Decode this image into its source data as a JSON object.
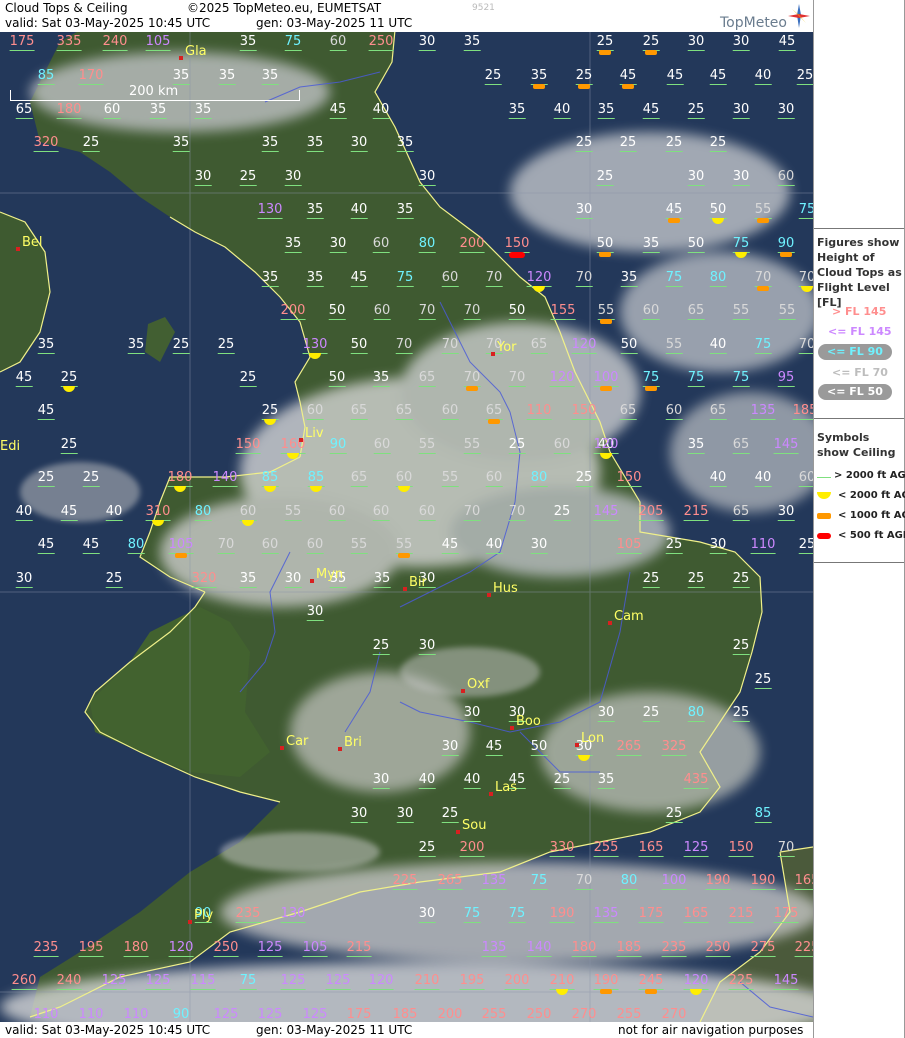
{
  "header": {
    "title": "Cloud Tops & Ceiling",
    "copyright": "©2025 TopMeteo.eu, EUMETSAT",
    "code": "9521",
    "valid": "valid:  Sat  03-May-2025  10:45 UTC",
    "gen": "gen: 03-May-2025 11 UTC",
    "logo": "TopMeteo"
  },
  "footer": {
    "valid": "valid:  Sat  03-May-2025  10:45 UTC",
    "gen": "gen: 03-May-2025 11 UTC",
    "disclaimer": "not for air navigation purposes"
  },
  "scale": {
    "label": "200 km"
  },
  "legend": {
    "figures_title": "Figures show Height of Cloud Tops as Flight Level  [FL]",
    "fl_above_145": "> FL 145",
    "fl_145": "<= FL 145",
    "fl_90": "<= FL 90",
    "fl_70": "<= FL 70",
    "fl_50": "<= FL 50",
    "symbols_title": "Symbols show Ceiling",
    "sym_2000_plus": "> 2000 ft AGL",
    "sym_2000": "< 2000 ft AGL",
    "sym_1000": "< 1000 ft AGL",
    "sym_500": "< 500 ft AGL",
    "colors": {
      "above145": "#ff8e8e",
      "fl145": "#cc88ff",
      "fl90": "#6ff2ff",
      "fl70": "#d9d9d9",
      "fl50": "#ffffff",
      "ok": "#7fe07f",
      "lt2000": "#ffee00",
      "lt1000": "#ff9800",
      "lt500": "#ff0000"
    }
  },
  "cities": [
    "Gla",
    "Bel",
    "Edi",
    "Yor",
    "Liv",
    "Myn",
    "Bir",
    "Hus",
    "Cam",
    "Oxf",
    "Boo",
    "Lon",
    "Car",
    "Bri",
    "Las",
    "Sou",
    "Ply"
  ],
  "fl_values": [
    {
      "v": "175",
      "c": "pk"
    },
    {
      "v": "335",
      "c": "pk"
    },
    {
      "v": "240",
      "c": "pk"
    },
    {
      "v": "105",
      "c": "pu"
    },
    {
      "v": "35",
      "c": "w"
    },
    {
      "v": "75",
      "c": "cy"
    },
    {
      "v": "60",
      "c": "g"
    },
    {
      "v": "250",
      "c": "pk"
    },
    {
      "v": "30",
      "c": "w"
    },
    {
      "v": "35",
      "c": "w"
    },
    {
      "v": "25",
      "c": "w",
      "s": "o"
    },
    {
      "v": "25",
      "c": "w",
      "s": "o"
    },
    {
      "v": "30",
      "c": "w"
    },
    {
      "v": "30",
      "c": "w"
    },
    {
      "v": "45",
      "c": "w"
    },
    {
      "v": "85",
      "c": "cy"
    },
    {
      "v": "170",
      "c": "pk"
    },
    {
      "v": "35",
      "c": "w"
    },
    {
      "v": "35",
      "c": "w"
    },
    {
      "v": "35",
      "c": "w"
    },
    {
      "v": "25",
      "c": "w"
    },
    {
      "v": "35",
      "c": "w",
      "s": "o"
    },
    {
      "v": "25",
      "c": "w",
      "s": "o"
    },
    {
      "v": "45",
      "c": "w",
      "s": "o"
    },
    {
      "v": "45",
      "c": "w"
    },
    {
      "v": "45",
      "c": "w"
    },
    {
      "v": "40",
      "c": "w"
    },
    {
      "v": "25",
      "c": "w"
    },
    {
      "v": "65",
      "c": "w"
    },
    {
      "v": "180",
      "c": "pk"
    },
    {
      "v": "60",
      "c": "w"
    },
    {
      "v": "35",
      "c": "w"
    },
    {
      "v": "35",
      "c": "w"
    },
    {
      "v": "45",
      "c": "w"
    },
    {
      "v": "40",
      "c": "w"
    },
    {
      "v": "35",
      "c": "w"
    },
    {
      "v": "40",
      "c": "w"
    },
    {
      "v": "35",
      "c": "w"
    },
    {
      "v": "45",
      "c": "w"
    },
    {
      "v": "25",
      "c": "w"
    },
    {
      "v": "30",
      "c": "w"
    },
    {
      "v": "30",
      "c": "w"
    },
    {
      "v": "320",
      "c": "pk"
    },
    {
      "v": "25",
      "c": "w"
    },
    {
      "v": "35",
      "c": "w"
    },
    {
      "v": "35",
      "c": "w"
    },
    {
      "v": "35",
      "c": "w"
    },
    {
      "v": "30",
      "c": "w"
    },
    {
      "v": "35",
      "c": "w"
    },
    {
      "v": "25",
      "c": "w"
    },
    {
      "v": "25",
      "c": "w"
    },
    {
      "v": "25",
      "c": "w"
    },
    {
      "v": "25",
      "c": "w"
    },
    {
      "v": "30",
      "c": "w"
    },
    {
      "v": "25",
      "c": "w"
    },
    {
      "v": "30",
      "c": "w"
    },
    {
      "v": "30",
      "c": "w"
    },
    {
      "v": "25",
      "c": "w"
    },
    {
      "v": "30",
      "c": "w"
    },
    {
      "v": "30",
      "c": "w"
    },
    {
      "v": "60",
      "c": "g"
    },
    {
      "v": "130",
      "c": "pu"
    },
    {
      "v": "35",
      "c": "w"
    },
    {
      "v": "40",
      "c": "w"
    },
    {
      "v": "35",
      "c": "w"
    },
    {
      "v": "30",
      "c": "w"
    },
    {
      "v": "45",
      "c": "w",
      "s": "o"
    },
    {
      "v": "50",
      "c": "w",
      "s": "y"
    },
    {
      "v": "55",
      "c": "g",
      "s": "o"
    },
    {
      "v": "75",
      "c": "cy"
    },
    {
      "v": "35",
      "c": "w"
    },
    {
      "v": "30",
      "c": "w"
    },
    {
      "v": "60",
      "c": "g"
    },
    {
      "v": "80",
      "c": "cy"
    },
    {
      "v": "200",
      "c": "pk"
    },
    {
      "v": "150",
      "c": "pk",
      "s": "r"
    },
    {
      "v": "50",
      "c": "w",
      "s": "o"
    },
    {
      "v": "35",
      "c": "w"
    },
    {
      "v": "50",
      "c": "w"
    },
    {
      "v": "75",
      "c": "cy",
      "s": "y"
    },
    {
      "v": "90",
      "c": "cy",
      "s": "o"
    },
    {
      "v": "35",
      "c": "w"
    },
    {
      "v": "35",
      "c": "w"
    },
    {
      "v": "45",
      "c": "w"
    },
    {
      "v": "75",
      "c": "cy"
    },
    {
      "v": "60",
      "c": "g"
    },
    {
      "v": "70",
      "c": "g"
    },
    {
      "v": "120",
      "c": "pu",
      "s": "y"
    },
    {
      "v": "70",
      "c": "g"
    },
    {
      "v": "35",
      "c": "w"
    },
    {
      "v": "75",
      "c": "cy"
    },
    {
      "v": "80",
      "c": "cy"
    },
    {
      "v": "70",
      "c": "g",
      "s": "o"
    },
    {
      "v": "70",
      "c": "g",
      "s": "y"
    },
    {
      "v": "200",
      "c": "pk"
    },
    {
      "v": "50",
      "c": "w"
    },
    {
      "v": "60",
      "c": "g"
    },
    {
      "v": "70",
      "c": "g"
    },
    {
      "v": "70",
      "c": "g"
    },
    {
      "v": "50",
      "c": "w"
    },
    {
      "v": "155",
      "c": "pk"
    },
    {
      "v": "55",
      "c": "g",
      "s": "o"
    },
    {
      "v": "60",
      "c": "g"
    },
    {
      "v": "65",
      "c": "g"
    },
    {
      "v": "55",
      "c": "g"
    },
    {
      "v": "55",
      "c": "g"
    },
    {
      "v": "35",
      "c": "w"
    },
    {
      "v": "35",
      "c": "w"
    },
    {
      "v": "25",
      "c": "w"
    },
    {
      "v": "25",
      "c": "w"
    },
    {
      "v": "130",
      "c": "pu",
      "s": "y"
    },
    {
      "v": "50",
      "c": "w"
    },
    {
      "v": "70",
      "c": "g"
    },
    {
      "v": "70",
      "c": "g"
    },
    {
      "v": "70",
      "c": "g"
    },
    {
      "v": "65",
      "c": "g"
    },
    {
      "v": "120",
      "c": "pu"
    },
    {
      "v": "50",
      "c": "w"
    },
    {
      "v": "55",
      "c": "g"
    },
    {
      "v": "40",
      "c": "w"
    },
    {
      "v": "75",
      "c": "cy"
    },
    {
      "v": "70",
      "c": "g"
    },
    {
      "v": "45",
      "c": "w"
    },
    {
      "v": "25",
      "c": "w",
      "s": "y"
    },
    {
      "v": "25",
      "c": "w"
    },
    {
      "v": "50",
      "c": "w"
    },
    {
      "v": "35",
      "c": "w"
    },
    {
      "v": "65",
      "c": "g"
    },
    {
      "v": "70",
      "c": "g",
      "s": "o"
    },
    {
      "v": "70",
      "c": "g"
    },
    {
      "v": "120",
      "c": "pu"
    },
    {
      "v": "100",
      "c": "pu",
      "s": "o"
    },
    {
      "v": "75",
      "c": "cy",
      "s": "o"
    },
    {
      "v": "75",
      "c": "cy"
    },
    {
      "v": "75",
      "c": "cy"
    },
    {
      "v": "95",
      "c": "pu"
    },
    {
      "v": "45",
      "c": "w"
    },
    {
      "v": "25",
      "c": "w",
      "s": "y"
    },
    {
      "v": "60",
      "c": "g"
    },
    {
      "v": "65",
      "c": "g"
    },
    {
      "v": "65",
      "c": "g"
    },
    {
      "v": "60",
      "c": "g"
    },
    {
      "v": "65",
      "c": "g",
      "s": "o"
    },
    {
      "v": "110",
      "c": "pk"
    },
    {
      "v": "150",
      "c": "pk"
    },
    {
      "v": "65",
      "c": "g"
    },
    {
      "v": "60",
      "c": "g"
    },
    {
      "v": "65",
      "c": "g"
    },
    {
      "v": "135",
      "c": "pu"
    },
    {
      "v": "185",
      "c": "pk"
    },
    {
      "v": "25",
      "c": "w"
    },
    {
      "v": "150",
      "c": "pk"
    },
    {
      "v": "160",
      "c": "pk",
      "s": "y"
    },
    {
      "v": "90",
      "c": "cy"
    },
    {
      "v": "60",
      "c": "g"
    },
    {
      "v": "55",
      "c": "g"
    },
    {
      "v": "55",
      "c": "g"
    },
    {
      "v": "25",
      "c": "w"
    },
    {
      "v": "60",
      "c": "g"
    },
    {
      "v": "40",
      "c": "w"
    },
    {
      "v": "120",
      "c": "pu",
      "s": "y"
    },
    {
      "v": "35",
      "c": "w"
    },
    {
      "v": "65",
      "c": "g"
    },
    {
      "v": "145",
      "c": "pu"
    },
    {
      "v": "25",
      "c": "w"
    },
    {
      "v": "25",
      "c": "w"
    },
    {
      "v": "180",
      "c": "pk",
      "s": "y"
    },
    {
      "v": "140",
      "c": "pu"
    },
    {
      "v": "85",
      "c": "cy",
      "s": "y"
    },
    {
      "v": "85",
      "c": "cy",
      "s": "y"
    },
    {
      "v": "65",
      "c": "g"
    },
    {
      "v": "60",
      "c": "g",
      "s": "y"
    },
    {
      "v": "55",
      "c": "g"
    },
    {
      "v": "60",
      "c": "g"
    },
    {
      "v": "80",
      "c": "cy"
    },
    {
      "v": "25",
      "c": "w"
    },
    {
      "v": "150",
      "c": "pk"
    },
    {
      "v": "40",
      "c": "w"
    },
    {
      "v": "40",
      "c": "w"
    },
    {
      "v": "60",
      "c": "g"
    },
    {
      "v": "40",
      "c": "w"
    },
    {
      "v": "45",
      "c": "w"
    },
    {
      "v": "40",
      "c": "w"
    },
    {
      "v": "310",
      "c": "pk",
      "s": "y"
    },
    {
      "v": "80",
      "c": "cy"
    },
    {
      "v": "60",
      "c": "g",
      "s": "y"
    },
    {
      "v": "55",
      "c": "g"
    },
    {
      "v": "60",
      "c": "g"
    },
    {
      "v": "60",
      "c": "g"
    },
    {
      "v": "60",
      "c": "g"
    },
    {
      "v": "70",
      "c": "g"
    },
    {
      "v": "70",
      "c": "g"
    },
    {
      "v": "25",
      "c": "w"
    },
    {
      "v": "145",
      "c": "pu"
    },
    {
      "v": "205",
      "c": "pk"
    },
    {
      "v": "215",
      "c": "pk"
    },
    {
      "v": "65",
      "c": "g"
    },
    {
      "v": "30",
      "c": "w"
    },
    {
      "v": "45",
      "c": "w"
    },
    {
      "v": "45",
      "c": "w"
    },
    {
      "v": "80",
      "c": "cy"
    },
    {
      "v": "105",
      "c": "pu",
      "s": "o"
    },
    {
      "v": "70",
      "c": "g"
    },
    {
      "v": "60",
      "c": "g"
    },
    {
      "v": "60",
      "c": "g"
    },
    {
      "v": "55",
      "c": "g"
    },
    {
      "v": "55",
      "c": "g",
      "s": "o"
    },
    {
      "v": "45",
      "c": "w"
    },
    {
      "v": "40",
      "c": "w"
    },
    {
      "v": "30",
      "c": "w"
    },
    {
      "v": "105",
      "c": "pk"
    },
    {
      "v": "25",
      "c": "w"
    },
    {
      "v": "30",
      "c": "w"
    },
    {
      "v": "110",
      "c": "pu"
    },
    {
      "v": "25",
      "c": "w"
    },
    {
      "v": "30",
      "c": "w"
    },
    {
      "v": "25",
      "c": "w"
    },
    {
      "v": "320",
      "c": "pk"
    },
    {
      "v": "35",
      "c": "w"
    },
    {
      "v": "30",
      "c": "w"
    },
    {
      "v": "35",
      "c": "w"
    },
    {
      "v": "35",
      "c": "w"
    },
    {
      "v": "30",
      "c": "w"
    },
    {
      "v": "25",
      "c": "w"
    },
    {
      "v": "25",
      "c": "w"
    },
    {
      "v": "25",
      "c": "w"
    },
    {
      "v": "30",
      "c": "w"
    },
    {
      "v": "25",
      "c": "w"
    },
    {
      "v": "30",
      "c": "w"
    },
    {
      "v": "25",
      "c": "w"
    },
    {
      "v": "25",
      "c": "w"
    },
    {
      "v": "30",
      "c": "w"
    },
    {
      "v": "30",
      "c": "w"
    },
    {
      "v": "30",
      "c": "w"
    },
    {
      "v": "25",
      "c": "w"
    },
    {
      "v": "80",
      "c": "cy"
    },
    {
      "v": "25",
      "c": "w"
    },
    {
      "v": "30",
      "c": "w"
    },
    {
      "v": "45",
      "c": "w"
    },
    {
      "v": "50",
      "c": "w"
    },
    {
      "v": "30",
      "c": "w",
      "s": "y"
    },
    {
      "v": "265",
      "c": "pk"
    },
    {
      "v": "325",
      "c": "pk"
    },
    {
      "v": "30",
      "c": "w"
    },
    {
      "v": "40",
      "c": "w"
    },
    {
      "v": "40",
      "c": "w"
    },
    {
      "v": "45",
      "c": "w"
    },
    {
      "v": "25",
      "c": "w"
    },
    {
      "v": "35",
      "c": "w"
    },
    {
      "v": "435",
      "c": "pk"
    },
    {
      "v": "30",
      "c": "w"
    },
    {
      "v": "30",
      "c": "w"
    },
    {
      "v": "25",
      "c": "w"
    },
    {
      "v": "25",
      "c": "w"
    },
    {
      "v": "85",
      "c": "cy"
    },
    {
      "v": "25",
      "c": "w"
    },
    {
      "v": "200",
      "c": "pk"
    },
    {
      "v": "330",
      "c": "pk"
    },
    {
      "v": "255",
      "c": "pk"
    },
    {
      "v": "165",
      "c": "pk"
    },
    {
      "v": "125",
      "c": "pu"
    },
    {
      "v": "150",
      "c": "pk"
    },
    {
      "v": "70",
      "c": "g"
    },
    {
      "v": "225",
      "c": "pk"
    },
    {
      "v": "265",
      "c": "pk"
    },
    {
      "v": "135",
      "c": "pu"
    },
    {
      "v": "75",
      "c": "cy"
    },
    {
      "v": "70",
      "c": "g"
    },
    {
      "v": "80",
      "c": "cy"
    },
    {
      "v": "100",
      "c": "pu"
    },
    {
      "v": "190",
      "c": "pk"
    },
    {
      "v": "190",
      "c": "pk"
    },
    {
      "v": "165",
      "c": "pk"
    },
    {
      "v": "90",
      "c": "cy"
    },
    {
      "v": "235",
      "c": "pk"
    },
    {
      "v": "130",
      "c": "pu"
    },
    {
      "v": "30",
      "c": "w"
    },
    {
      "v": "75",
      "c": "cy"
    },
    {
      "v": "75",
      "c": "cy"
    },
    {
      "v": "190",
      "c": "pk"
    },
    {
      "v": "135",
      "c": "pu"
    },
    {
      "v": "175",
      "c": "pk"
    },
    {
      "v": "165",
      "c": "pk"
    },
    {
      "v": "215",
      "c": "pk"
    },
    {
      "v": "175",
      "c": "pk"
    },
    {
      "v": "235",
      "c": "pk"
    },
    {
      "v": "195",
      "c": "pk"
    },
    {
      "v": "180",
      "c": "pk"
    },
    {
      "v": "120",
      "c": "pu"
    },
    {
      "v": "250",
      "c": "pk"
    },
    {
      "v": "125",
      "c": "pu"
    },
    {
      "v": "105",
      "c": "pu"
    },
    {
      "v": "215",
      "c": "pk"
    },
    {
      "v": "135",
      "c": "pu"
    },
    {
      "v": "140",
      "c": "pu"
    },
    {
      "v": "180",
      "c": "pk"
    },
    {
      "v": "185",
      "c": "pk"
    },
    {
      "v": "235",
      "c": "pk"
    },
    {
      "v": "250",
      "c": "pk"
    },
    {
      "v": "275",
      "c": "pk"
    },
    {
      "v": "225",
      "c": "pk"
    },
    {
      "v": "260",
      "c": "pk"
    },
    {
      "v": "240",
      "c": "pk"
    },
    {
      "v": "125",
      "c": "pu"
    },
    {
      "v": "125",
      "c": "pu"
    },
    {
      "v": "115",
      "c": "pu"
    },
    {
      "v": "75",
      "c": "cy"
    },
    {
      "v": "125",
      "c": "pu"
    },
    {
      "v": "125",
      "c": "pu"
    },
    {
      "v": "120",
      "c": "pu"
    },
    {
      "v": "210",
      "c": "pk"
    },
    {
      "v": "195",
      "c": "pk"
    },
    {
      "v": "200",
      "c": "pk"
    },
    {
      "v": "210",
      "c": "pk",
      "s": "y"
    },
    {
      "v": "190",
      "c": "pk",
      "s": "o"
    },
    {
      "v": "245",
      "c": "pk",
      "s": "o"
    },
    {
      "v": "120",
      "c": "pu",
      "s": "y"
    },
    {
      "v": "225",
      "c": "pk"
    },
    {
      "v": "145",
      "c": "pu"
    },
    {
      "v": "110",
      "c": "pu"
    },
    {
      "v": "110",
      "c": "pu"
    },
    {
      "v": "110",
      "c": "pu"
    },
    {
      "v": "90",
      "c": "cy"
    },
    {
      "v": "125",
      "c": "pu"
    },
    {
      "v": "125",
      "c": "pu"
    },
    {
      "v": "125",
      "c": "pu"
    },
    {
      "v": "175",
      "c": "pk"
    },
    {
      "v": "185",
      "c": "pk"
    },
    {
      "v": "200",
      "c": "pk"
    },
    {
      "v": "255",
      "c": "pk"
    },
    {
      "v": "250",
      "c": "pk"
    },
    {
      "v": "270",
      "c": "pk"
    },
    {
      "v": "255",
      "c": "pk"
    },
    {
      "v": "270",
      "c": "pk"
    }
  ]
}
